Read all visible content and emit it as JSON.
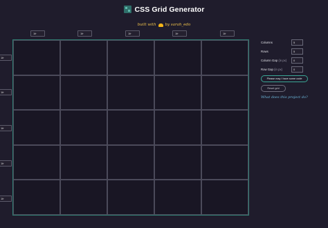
{
  "header": {
    "title": "CSS Grid Generator",
    "byline_prefix": "built with",
    "byline_suffix": "by sarah_edo"
  },
  "column_inputs": [
    "1fr",
    "1fr",
    "1fr",
    "1fr",
    "1fr"
  ],
  "row_inputs": [
    "1fr",
    "1fr",
    "1fr",
    "1fr",
    "1fr"
  ],
  "panel": {
    "columns_label": "Columns",
    "columns_value": "5",
    "rows_label": "Rows",
    "rows_value": "5",
    "column_gap_label": "Column Gap",
    "column_gap_unit": "(in px)",
    "column_gap_value": "0",
    "row_gap_label": "Row Gap",
    "row_gap_unit": "(in px)",
    "row_gap_value": "0",
    "code_button": "Please may I have some code",
    "reset_button": "Reset grid",
    "help_link": "What does this project do?"
  },
  "colors": {
    "background": "#1f1c2c",
    "accent": "#3aa896",
    "title": "#ffffff",
    "byline": "#f0c34b",
    "link": "#6ebce0"
  }
}
